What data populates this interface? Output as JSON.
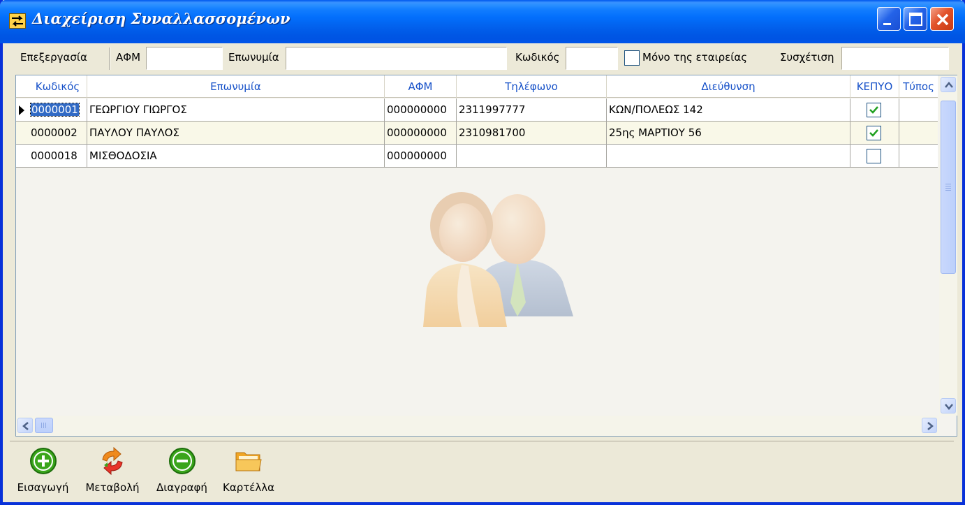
{
  "window": {
    "title": "Διαχείριση Συναλλασσομένων"
  },
  "filter": {
    "edit_label": "Επεξεργασία",
    "afm_label": "ΑΦΜ",
    "afm_value": "",
    "name_label": "Επωνυμία",
    "name_value": "",
    "code_label": "Κωδικός",
    "code_value": "",
    "only_company_label": "Μόνο της εταιρείας",
    "only_company_checked": false,
    "relation_label": "Συσχέτιση",
    "relation_value": ""
  },
  "grid": {
    "columns": [
      "Κωδικός",
      "Επωνυμία",
      "ΑΦΜ",
      "Τηλέφωνο",
      "Διεύθυνση",
      "ΚΕΠΥΟ",
      "Τύπος"
    ],
    "rows": [
      {
        "code": "0000001",
        "name": "ΓΕΩΡΓΙΟΥ ΓΙΩΡΓΟΣ",
        "afm": "000000000",
        "phone": "2311997777",
        "address": "ΚΩΝ/ΠΟΛΕΩΣ 142",
        "kepyo": true,
        "type": ""
      },
      {
        "code": "0000002",
        "name": "ΠΑΥΛΟΥ ΠΑΥΛΟΣ",
        "afm": "000000000",
        "phone": "2310981700",
        "address": "25ης ΜΑΡΤΙΟΥ 56",
        "kepyo": true,
        "type": ""
      },
      {
        "code": "0000018",
        "name": "ΜΙΣΘΟΔΟΣΙΑ",
        "afm": "000000000",
        "phone": "",
        "address": "",
        "kepyo": false,
        "type": ""
      }
    ],
    "selected_row": 0,
    "watermark_icon": "users-icon"
  },
  "toolbar": {
    "insert_label": "Εισαγωγή",
    "edit_label": "Μεταβολή",
    "delete_label": "Διαγραφή",
    "card_label": "Καρτέλλα"
  },
  "colors": {
    "title_bar": "#0054e3",
    "header_text": "#1550c8",
    "selection": "#316ac5",
    "window_bg": "#ece9d8",
    "add_green": "#3aa51b",
    "folder_orange": "#f5b83d"
  }
}
